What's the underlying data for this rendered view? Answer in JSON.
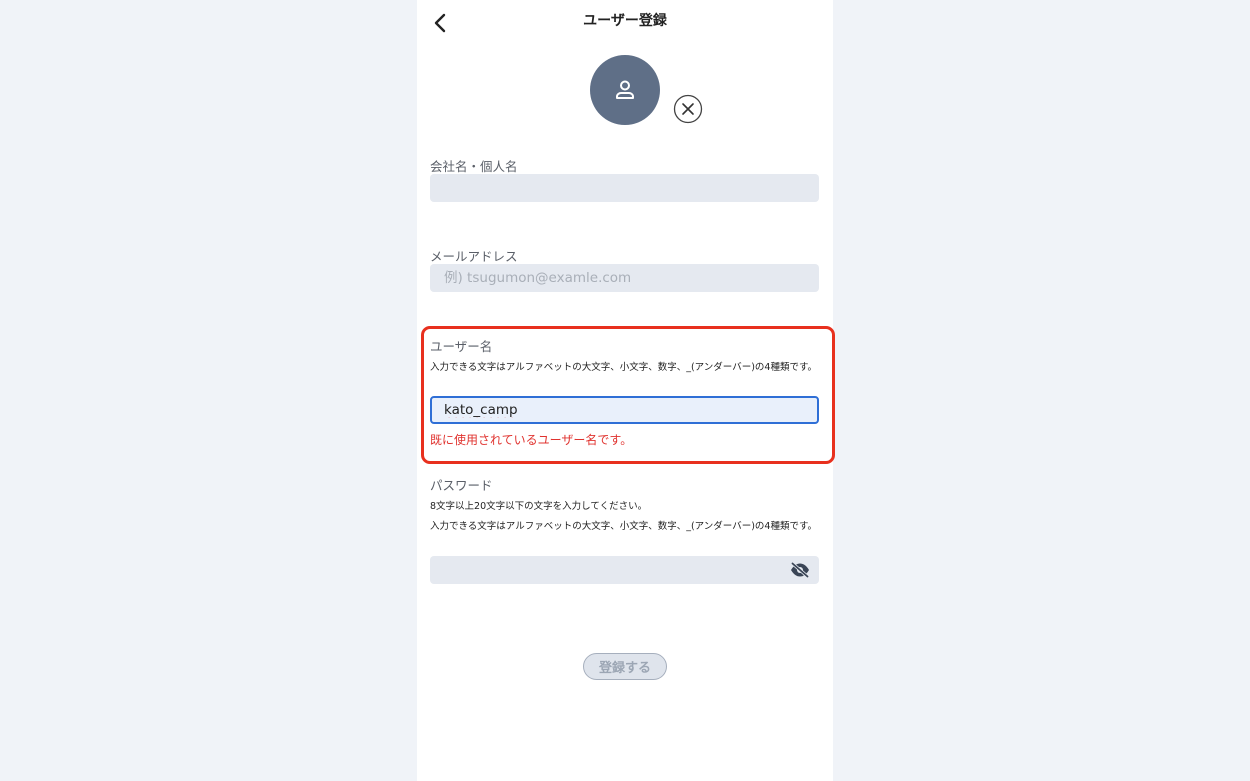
{
  "header": {
    "title": "ユーザー登録"
  },
  "company": {
    "label": "会社名・個人名",
    "value": "",
    "placeholder": ""
  },
  "email": {
    "label": "メールアドレス",
    "value": "",
    "placeholder": "例) tsugumon@examle.com"
  },
  "username": {
    "label": "ユーザー名",
    "hint": "入力できる文字はアルファベットの大文字、小文字、数字、_(アンダーバー)の4種類です。",
    "value": "kato_camp",
    "error": "既に使用されているユーザー名です。"
  },
  "password": {
    "label": "パスワード",
    "hint1": "8文字以上20文字以下の文字を入力してください。",
    "hint2": "入力できる文字はアルファベットの大文字、小文字、数字、_(アンダーバー)の4種類です。",
    "value": ""
  },
  "submit": {
    "label": "登録する"
  },
  "colors": {
    "error": "#e0332f",
    "avatar_bg": "#5f6f87",
    "focus_border": "#2f6fd6",
    "annotation": "#e8301e"
  },
  "icons": [
    "chevron-left-icon",
    "user-icon",
    "close-circle-icon",
    "eye-off-icon"
  ]
}
